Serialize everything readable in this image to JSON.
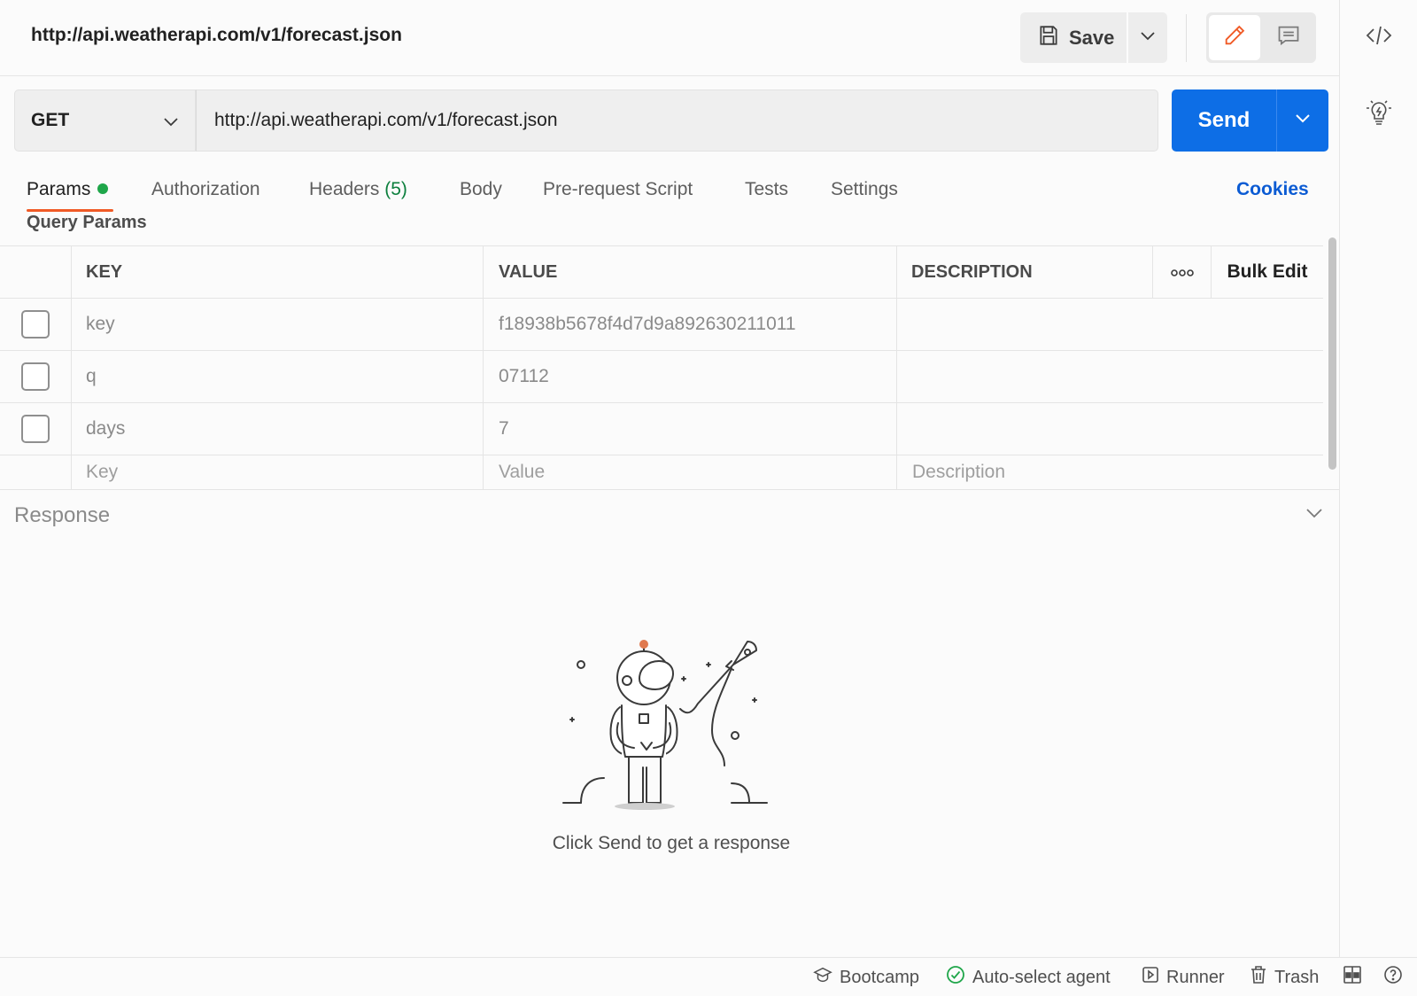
{
  "header": {
    "title": "http://api.weatherapi.com/v1/forecast.json",
    "save_label": "Save"
  },
  "request": {
    "method": "GET",
    "url": "http://api.weatherapi.com/v1/forecast.json",
    "send_label": "Send"
  },
  "tabs": [
    {
      "label": "Params",
      "active": true
    },
    {
      "label": "Authorization"
    },
    {
      "label": "Headers",
      "count": "(5)"
    },
    {
      "label": "Body"
    },
    {
      "label": "Pre-request Script"
    },
    {
      "label": "Tests"
    },
    {
      "label": "Settings"
    }
  ],
  "cookies_label": "Cookies",
  "query_params": {
    "title": "Query Params",
    "columns": {
      "key": "KEY",
      "value": "VALUE",
      "description": "DESCRIPTION",
      "bulk_edit": "Bulk Edit"
    },
    "rows": [
      {
        "key": "key",
        "value": "f18938b5678f4d7d9a892630211011"
      },
      {
        "key": "q",
        "value": "07112"
      },
      {
        "key": "days",
        "value": "7"
      }
    ],
    "placeholders": {
      "key": "Key",
      "value": "Value",
      "description": "Description"
    }
  },
  "response": {
    "title": "Response",
    "empty_message": "Click Send to get a response"
  },
  "footer": {
    "bootcamp": "Bootcamp",
    "agent": "Auto-select agent",
    "runner": "Runner",
    "trash": "Trash"
  },
  "colors": {
    "accent_blue": "#0d6ee6",
    "active_tab_underline": "#f05a26",
    "status_green": "#1fa64a",
    "link_blue": "#0b5bd3"
  },
  "icons": [
    "save-icon",
    "chevron-down-icon",
    "pencil-icon",
    "comment-icon",
    "code-icon",
    "lightbulb-icon",
    "more-icon",
    "bootcamp-icon",
    "check-circle-icon",
    "runner-icon",
    "trash-icon",
    "layout-icon",
    "help-icon"
  ]
}
